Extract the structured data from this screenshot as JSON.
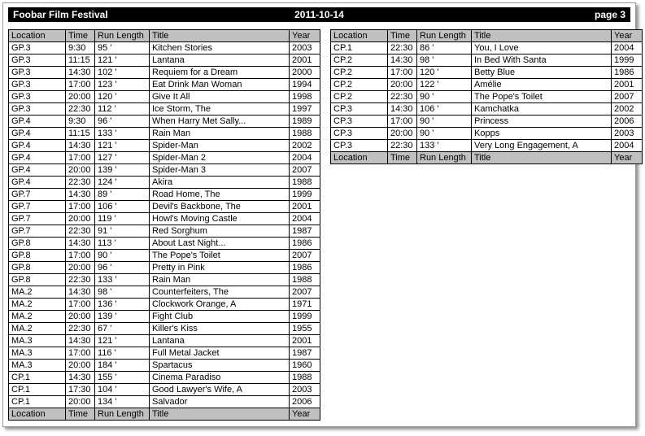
{
  "header": {
    "title": "Foobar Film Festival",
    "date": "2011-10-14",
    "page_label": "page 3"
  },
  "columns": [
    "Location",
    "Time",
    "Run Length",
    "Title",
    "Year"
  ],
  "tables": [
    {
      "name": "left-schedule-table",
      "rows": [
        [
          "GP.3",
          "9:30",
          "95 '",
          "Kitchen Stories",
          "2003"
        ],
        [
          "GP.3",
          "11:15",
          "121 '",
          "Lantana",
          "2001"
        ],
        [
          "GP.3",
          "14:30",
          "102 '",
          "Requiem for a Dream",
          "2000"
        ],
        [
          "GP.3",
          "17:00",
          "123 '",
          "Eat Drink Man Woman",
          "1994"
        ],
        [
          "GP.3",
          "20:00",
          "120 '",
          "Give It All",
          "1998"
        ],
        [
          "GP.3",
          "22:30",
          "112 '",
          "Ice Storm, The",
          "1997"
        ],
        [
          "GP.4",
          "9:30",
          "96 '",
          "When Harry Met Sally...",
          "1989"
        ],
        [
          "GP.4",
          "11:15",
          "133 '",
          "Rain Man",
          "1988"
        ],
        [
          "GP.4",
          "14:30",
          "121 '",
          "Spider-Man",
          "2002"
        ],
        [
          "GP.4",
          "17:00",
          "127 '",
          "Spider-Man 2",
          "2004"
        ],
        [
          "GP.4",
          "20:00",
          "139 '",
          "Spider-Man 3",
          "2007"
        ],
        [
          "GP.4",
          "22:30",
          "124 '",
          "Akira",
          "1988"
        ],
        [
          "GP.7",
          "14:30",
          "89 '",
          "Road Home, The",
          "1999"
        ],
        [
          "GP.7",
          "17:00",
          "106 '",
          "Devil's Backbone, The",
          "2001"
        ],
        [
          "GP.7",
          "20:00",
          "119 '",
          "Howl's Moving Castle",
          "2004"
        ],
        [
          "GP.7",
          "22:30",
          "91 '",
          "Red Sorghum",
          "1987"
        ],
        [
          "GP.8",
          "14:30",
          "113 '",
          "About Last Night...",
          "1986"
        ],
        [
          "GP.8",
          "17:00",
          "90 '",
          "The Pope's Toilet",
          "2007"
        ],
        [
          "GP.8",
          "20:00",
          "96 '",
          "Pretty in Pink",
          "1986"
        ],
        [
          "GP.8",
          "22:30",
          "133 '",
          "Rain Man",
          "1988"
        ],
        [
          "MA.2",
          "14:30",
          "98 '",
          "Counterfeiters, The",
          "2007"
        ],
        [
          "MA.2",
          "17:00",
          "136 '",
          "Clockwork Orange, A",
          "1971"
        ],
        [
          "MA.2",
          "20:00",
          "139 '",
          "Fight Club",
          "1999"
        ],
        [
          "MA.2",
          "22:30",
          "67 '",
          "Killer's Kiss",
          "1955"
        ],
        [
          "MA.3",
          "14:30",
          "121 '",
          "Lantana",
          "2001"
        ],
        [
          "MA.3",
          "17:00",
          "116 '",
          "Full Metal Jacket",
          "1987"
        ],
        [
          "MA.3",
          "20:00",
          "184 '",
          "Spartacus",
          "1960"
        ],
        [
          "CP.1",
          "14:30",
          "155 '",
          "Cinema Paradiso",
          "1988"
        ],
        [
          "CP.1",
          "17:30",
          "104 '",
          "Good Lawyer's Wife, A",
          "2003"
        ],
        [
          "CP.1",
          "20:00",
          "134 '",
          "Salvador",
          "2006"
        ]
      ]
    },
    {
      "name": "right-schedule-table",
      "rows": [
        [
          "CP.1",
          "22:30",
          "86 '",
          "You, I Love",
          "2004"
        ],
        [
          "CP.2",
          "14:30",
          "98 '",
          "In Bed With Santa",
          "1999"
        ],
        [
          "CP.2",
          "17:00",
          "120 '",
          "Betty Blue",
          "1986"
        ],
        [
          "CP.2",
          "20:00",
          "122 '",
          "Amélie",
          "2001"
        ],
        [
          "CP.2",
          "22:30",
          "90 '",
          "The Pope's Toilet",
          "2007"
        ],
        [
          "CP.3",
          "14:30",
          "106 '",
          "Kamchatka",
          "2002"
        ],
        [
          "CP.3",
          "17:00",
          "90 '",
          "Princess",
          "2006"
        ],
        [
          "CP.3",
          "20:00",
          "90 '",
          "Kopps",
          "2003"
        ],
        [
          "CP.3",
          "22:30",
          "133 '",
          "Very Long Engagement, A",
          "2004"
        ]
      ]
    }
  ]
}
